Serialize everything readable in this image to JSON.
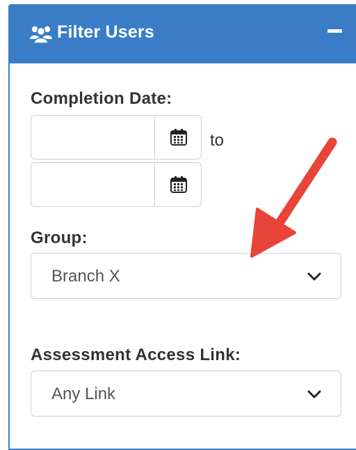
{
  "panel": {
    "title": "Filter Users",
    "header_icon": "users-icon",
    "collapse_icon": "minus-icon"
  },
  "completion_date": {
    "label": "Completion Date:",
    "from_value": "",
    "to_value": "",
    "separator": "to",
    "calendar_icon": "calendar-icon"
  },
  "group": {
    "label": "Group:",
    "selected": "Branch X"
  },
  "assessment_link": {
    "label": "Assessment Access Link:",
    "selected": "Any Link"
  },
  "annotation": {
    "arrow_color": "#e8443a"
  },
  "colors": {
    "header_bg": "#3a7cc6",
    "header_text": "#ffffff",
    "label_text": "#333333"
  }
}
